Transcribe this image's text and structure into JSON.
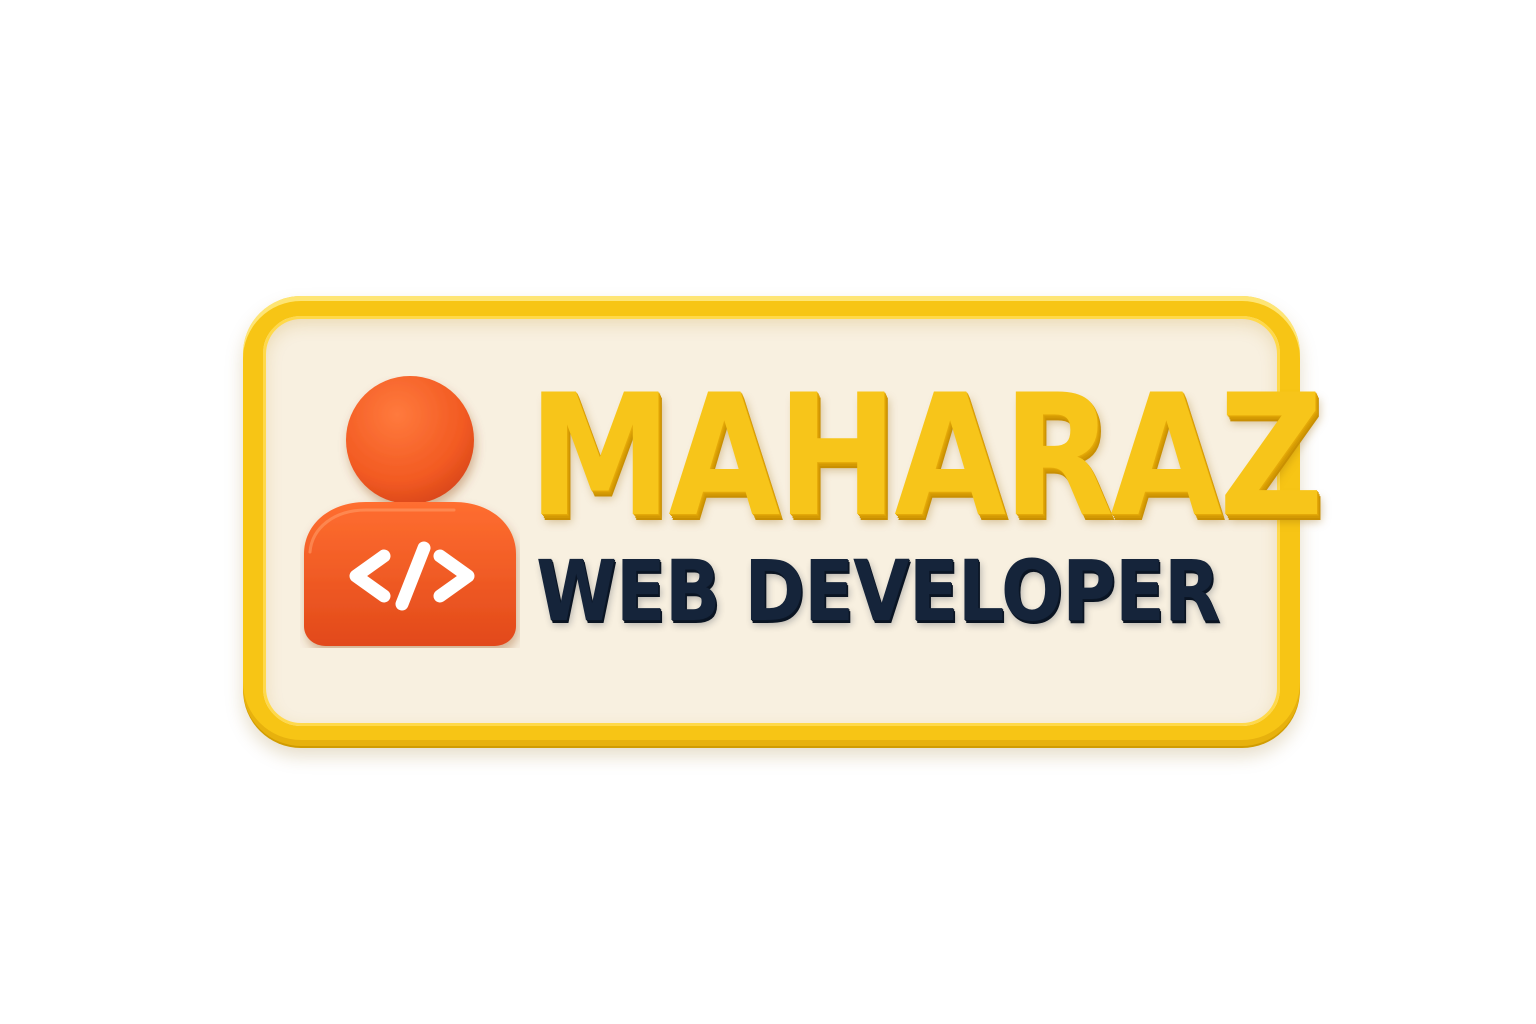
{
  "badge": {
    "name": "MAHARAZ",
    "role": "WEB DEVELOPER",
    "icon": "developer-avatar-icon",
    "code_glyph": "</>"
  },
  "colors": {
    "frame": "#f7c515",
    "panel": "#f8f0e0",
    "name_text": "#f7c51a",
    "role_text": "#15243a",
    "avatar": "#f25a22",
    "code_glyph": "#ffffff"
  }
}
